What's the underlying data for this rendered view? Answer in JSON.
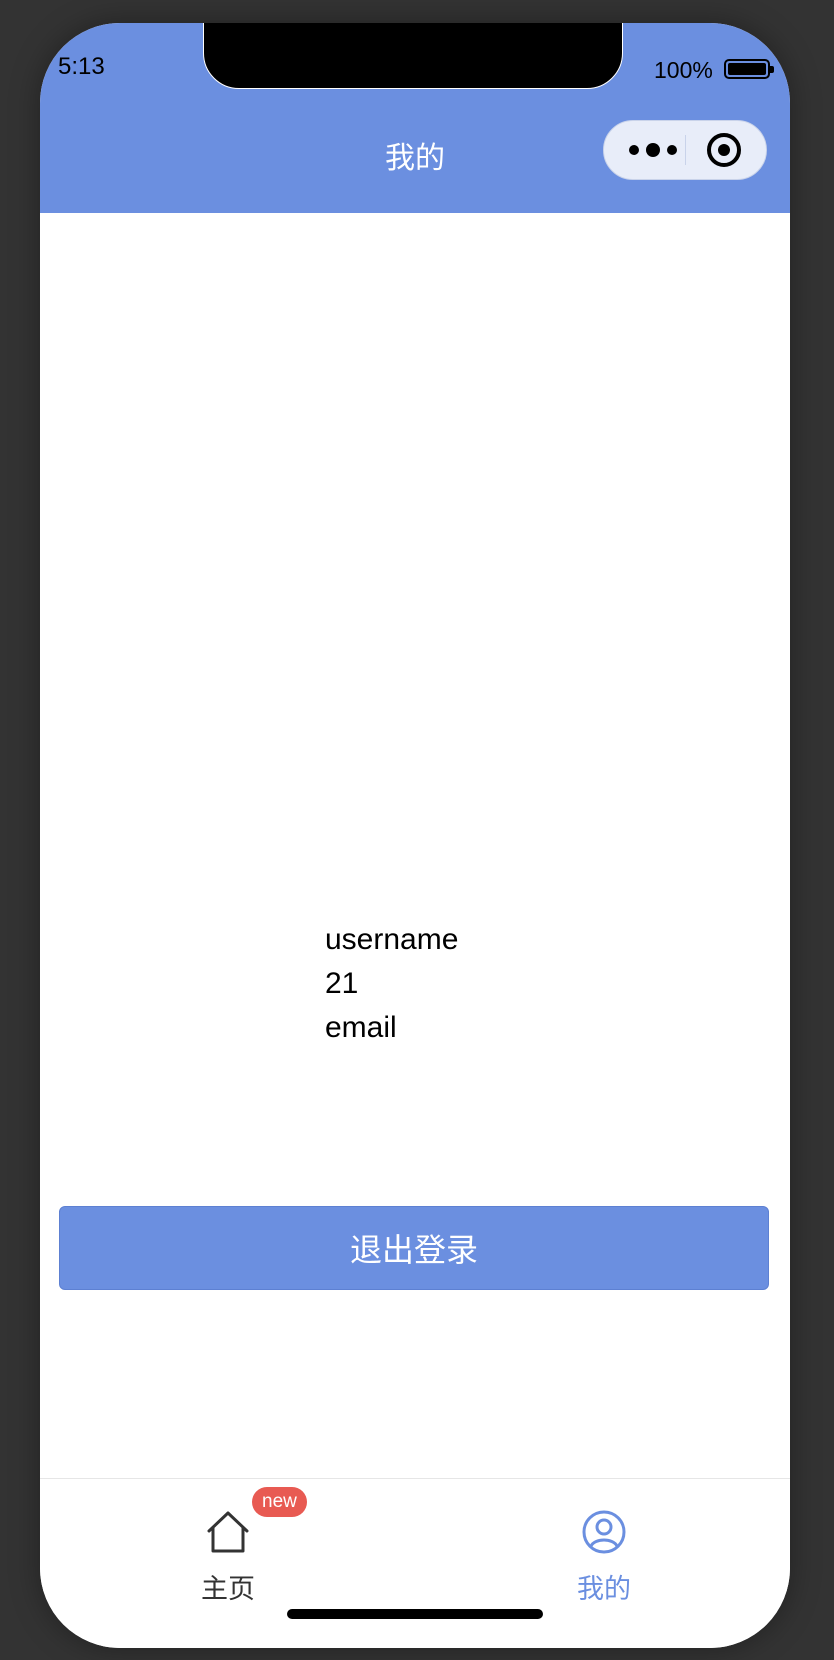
{
  "status_bar": {
    "time": "5:13",
    "battery_percent": "100%",
    "battery_level": 1.0
  },
  "nav": {
    "title": "我的",
    "color": "#6b8fe0"
  },
  "capsule": {
    "more_icon": "more-dots-icon",
    "close_icon": "target-circle-icon"
  },
  "profile": {
    "username": "username",
    "age": "21",
    "email": "email"
  },
  "actions": {
    "logout_label": "退出登录"
  },
  "tabbar": {
    "items": [
      {
        "label": "主页",
        "icon": "home-icon",
        "badge": "new",
        "active": false
      },
      {
        "label": "我的",
        "icon": "user-circle-icon",
        "active": true
      }
    ],
    "active_color": "#6b8fe0",
    "badge_color": "#e85a52"
  }
}
